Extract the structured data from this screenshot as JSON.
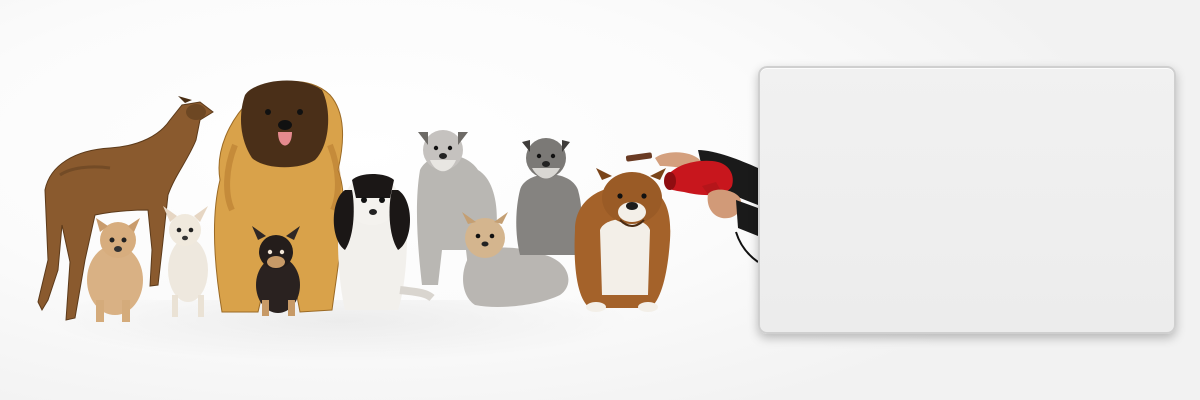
{
  "scene": {
    "description_subjects": [
      "greyhound",
      "chihuahua",
      "leonberger",
      "chihuahua-puppy",
      "cavalier-king-charles",
      "schnauzer",
      "yorkshire-terrier",
      "schnauzer",
      "bulldog",
      "groomer-hand-with-hair-dryer"
    ],
    "dryer_color": "#c8161d",
    "panel_color": "#ededed"
  },
  "panel": {
    "text": ""
  }
}
